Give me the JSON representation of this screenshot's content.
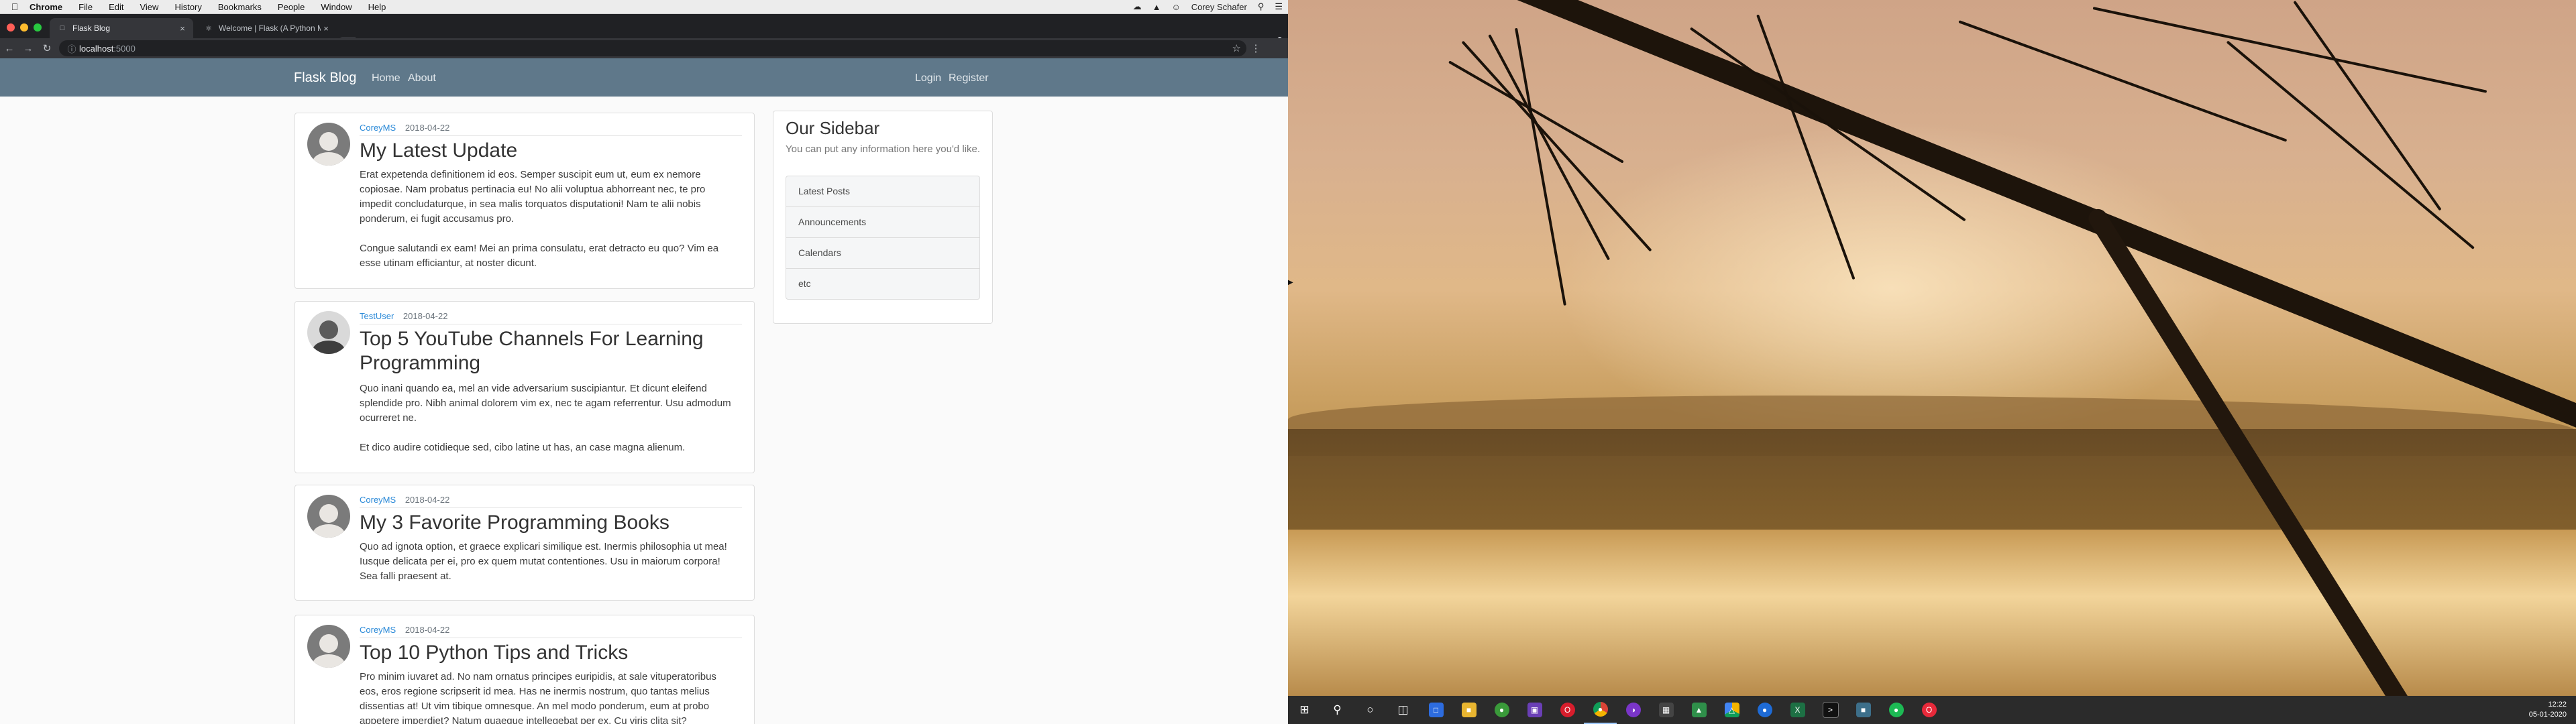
{
  "mac_menubar": {
    "apple_icon": "apple-icon",
    "app_name": "Chrome",
    "menus": [
      "File",
      "Edit",
      "View",
      "History",
      "Bookmarks",
      "People",
      "Window",
      "Help"
    ],
    "user_name": "Corey Schafer"
  },
  "browser": {
    "tabs": [
      {
        "title": "Flask Blog",
        "active": true
      },
      {
        "title": "Welcome | Flask (A Python Mi",
        "active": false
      }
    ],
    "address": {
      "host": "localhost",
      "port": ":5000"
    }
  },
  "site": {
    "brand": "Flask Blog",
    "nav_left": [
      "Home",
      "About"
    ],
    "nav_right": [
      "Login",
      "Register"
    ],
    "posts": [
      {
        "author": "CoreyMS",
        "date": "2018-04-22",
        "title": "My Latest Update",
        "content": "Erat expetenda definitionem id eos. Semper suscipit eum ut, eum ex nemore\ncopiosae. Nam probatus pertinacia eu! No alii voluptua abhorreant nec, te pro\nimpedit concludaturque, in sea malis torquatos disputationi! Nam te alii nobis\nponderum, ei fugit accusamus pro.\n\nCongue salutandi ex eam! Mei an prima consulatu, erat detracto eu quo? Vim ea\nesse utinam efficiantur, at noster dicunt."
      },
      {
        "author": "TestUser",
        "date": "2018-04-22",
        "title": "Top 5 YouTube Channels For Learning Programming",
        "content": "Quo inani quando ea, mel an vide adversarium suscipiantur. Et dicunt eleifend\nsplendide pro. Nibh animal dolorem vim ex, nec te agam referrentur. Usu admodum\nocurreret ne.\n\nEt dico audire cotidieque sed, cibo latine ut has, an case magna alienum."
      },
      {
        "author": "CoreyMS",
        "date": "2018-04-22",
        "title": "My 3 Favorite Programming Books",
        "content": "Quo ad ignota option, et graece explicari similique est. Inermis philosophia ut mea!\nIusque delicata per ei, pro ex quem mutat contentiones. Usu in maiorum corpora!\nSea falli praesent at."
      },
      {
        "author": "CoreyMS",
        "date": "2018-04-22",
        "title": "Top 10 Python Tips and Tricks",
        "content": "Pro minim iuvaret ad. No nam ornatus principes euripidis, at sale vituperatoribus\neos, eros regione scripserit id mea. Has ne inermis nostrum, quo tantas melius\ndissentias at! Ut vim tibique omnesque. An mel modo ponderum, eum at probo\nappetere imperdiet? Natum quaeque intellegebat per ex. Cu viris clita sit?"
      }
    ],
    "sidebar": {
      "title": "Our Sidebar",
      "description": "You can put any information here you'd like.",
      "items": [
        "Latest Posts",
        "Announcements",
        "Calendars",
        "etc"
      ]
    }
  },
  "windows": {
    "taskbar_icons": [
      "windows-start-icon",
      "search-icon",
      "cortana-icon",
      "task-view-icon",
      "monitor-app-icon",
      "file-explorer-icon",
      "green-app-icon",
      "purple-app-icon",
      "opera-icon",
      "chrome-icon",
      "purple-circle-app-icon",
      "dark-app-icon",
      "green-box-app-icon",
      "drive-icon",
      "blue-app-icon",
      "excel-icon",
      "terminal-icon",
      "network-app-icon",
      "spotify-icon",
      "opera-gx-icon"
    ],
    "clock": {
      "time": "12:22",
      "date": "05-01-2020"
    }
  },
  "colors": {
    "navbar": "#5f788a",
    "link_blue": "#2b8ad8",
    "chrome_dark": "#202124"
  }
}
